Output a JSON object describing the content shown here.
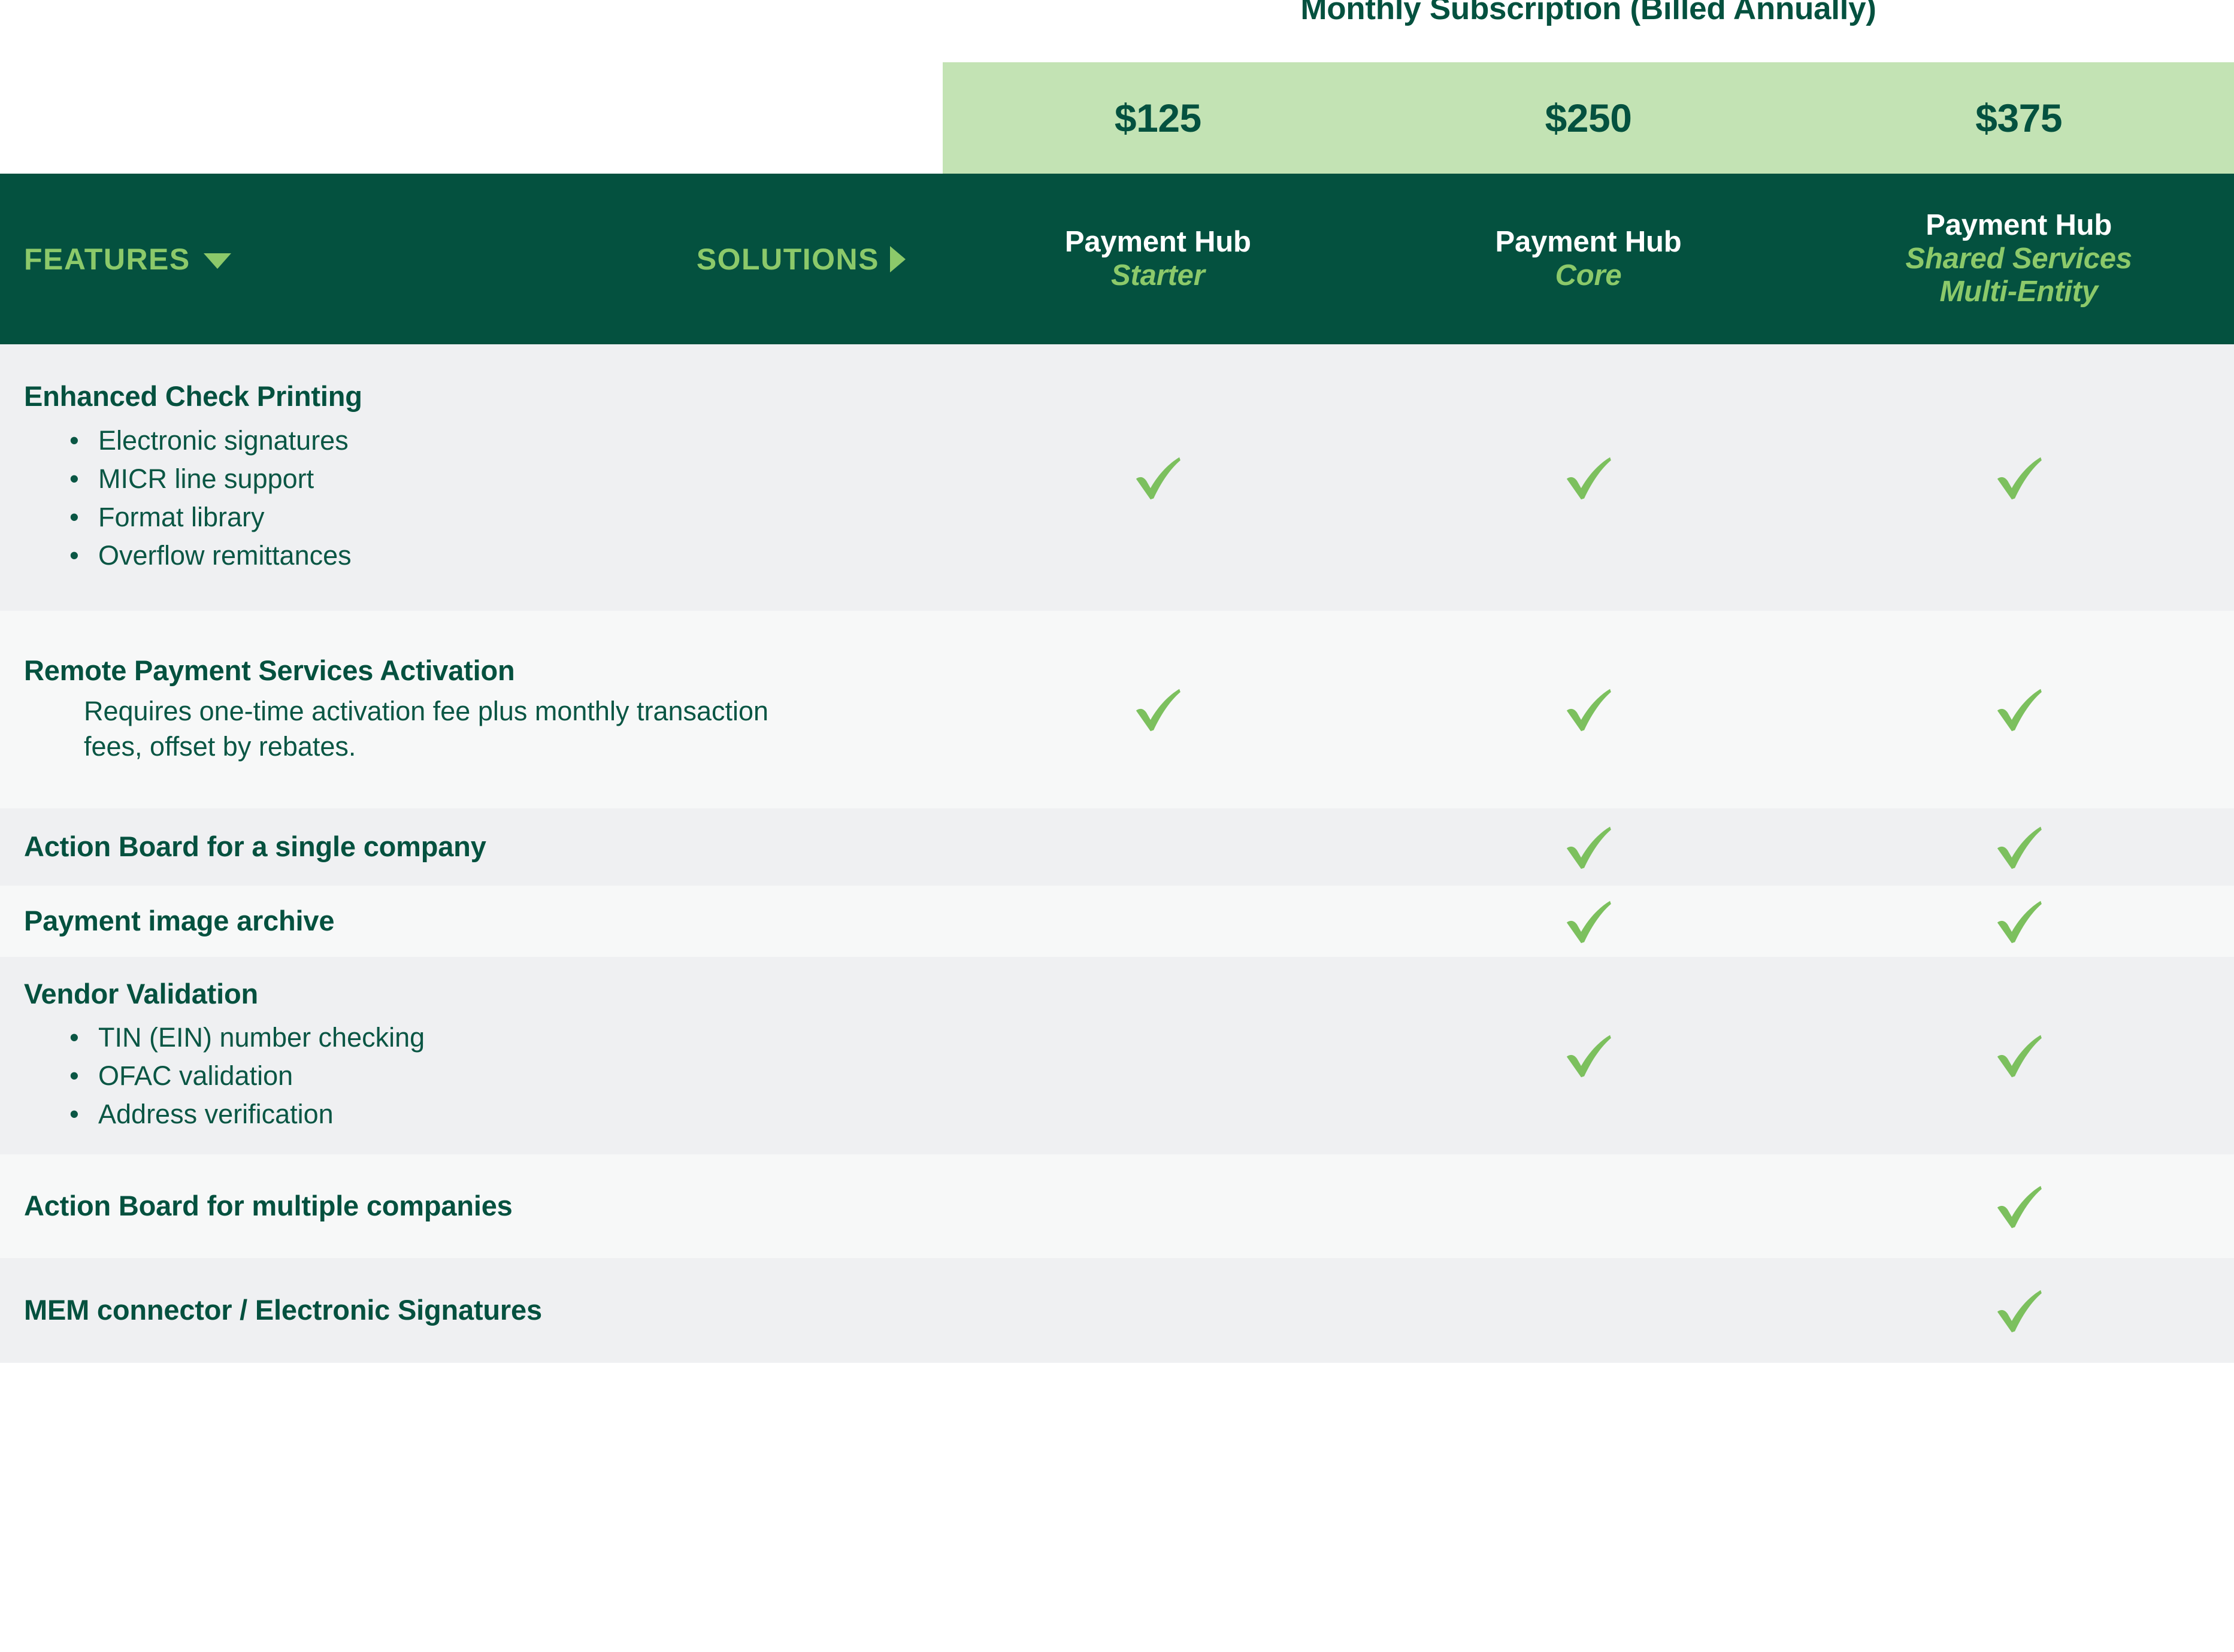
{
  "banner": {
    "subscription_title": "Monthly Subscription (Billed Annually)",
    "prices": [
      "$125",
      "$250",
      "$375"
    ],
    "banner_color": "#c3e3b4"
  },
  "header": {
    "features_label": "FEATURES",
    "features_icon": "chevron-down-icon",
    "solutions_label": "SOLUTIONS",
    "solutions_icon": "chevron-right-icon",
    "header_color": "#04513f",
    "accent_color": "#8cc96a",
    "plans": [
      {
        "name": "Payment Hub",
        "tier": "Starter"
      },
      {
        "name": "Payment Hub",
        "tier": "Core"
      },
      {
        "name": "Payment Hub",
        "tier": "Shared Services\nMulti-Entity"
      }
    ]
  },
  "plan_tier_lines": {
    "starter": "Starter",
    "core": "Core",
    "shared_1": "Shared Services",
    "shared_2": "Multi-Entity"
  },
  "check_color": "#7cc05e",
  "rows": [
    {
      "title": "Enhanced Check Printing",
      "bullets": [
        "Electronic signatures",
        "MICR line support",
        "Format library",
        "Overflow remittances"
      ],
      "description": "",
      "starter": true,
      "core": true,
      "shared": true
    },
    {
      "title": "Remote Payment Services Activation",
      "bullets": [],
      "description": "Requires one-time activation fee plus monthly transaction fees, offset by rebates.",
      "starter": true,
      "core": true,
      "shared": true
    },
    {
      "title": "Action Board for a single company",
      "bullets": [],
      "description": "",
      "starter": false,
      "core": true,
      "shared": true
    },
    {
      "title": "Payment image archive",
      "bullets": [],
      "description": "",
      "starter": false,
      "core": true,
      "shared": true
    },
    {
      "title": "Vendor Validation",
      "bullets": [
        "TIN (EIN) number checking",
        "OFAC validation",
        "Address verification"
      ],
      "description": "",
      "starter": false,
      "core": true,
      "shared": true
    },
    {
      "title": "Action Board for multiple companies",
      "bullets": [],
      "description": "",
      "starter": false,
      "core": false,
      "shared": true
    },
    {
      "title": "MEM connector / Electronic Signatures",
      "bullets": [],
      "description": "",
      "starter": false,
      "core": false,
      "shared": true
    }
  ]
}
